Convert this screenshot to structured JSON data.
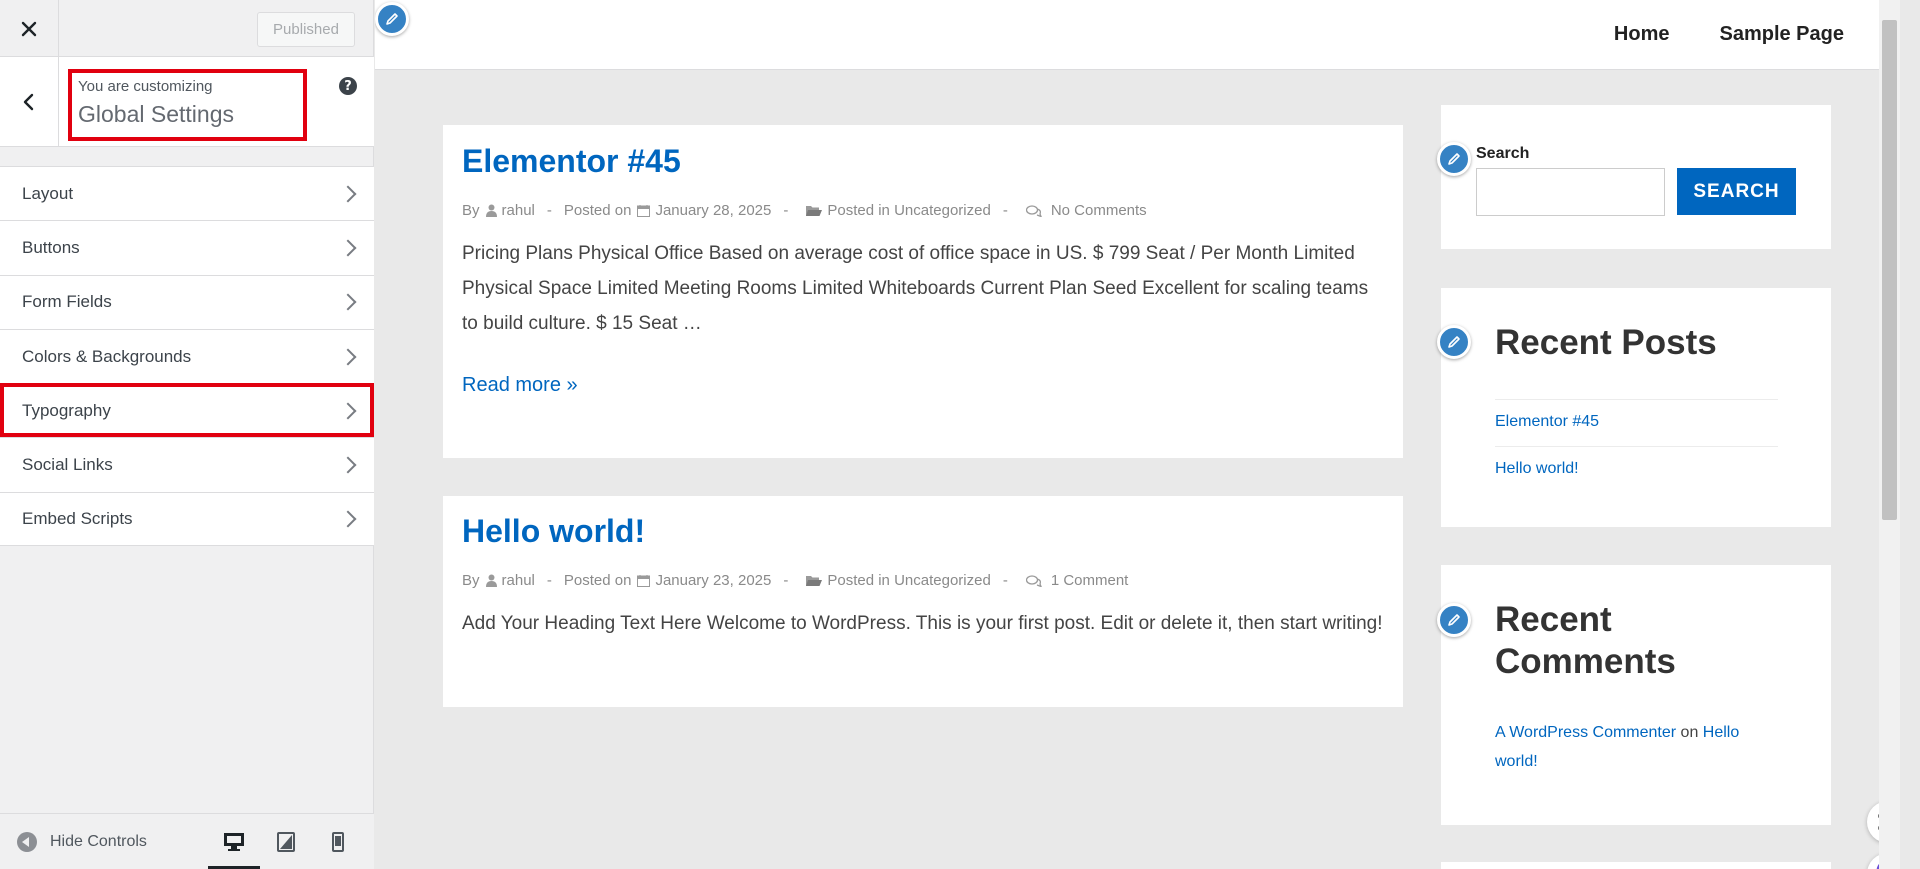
{
  "sidebar": {
    "publish_label": "Published",
    "title_pre": "You are customizing",
    "title_main": "Global Settings",
    "help_glyph": "?",
    "items": [
      {
        "label": "Layout"
      },
      {
        "label": "Buttons"
      },
      {
        "label": "Form Fields"
      },
      {
        "label": "Colors & Backgrounds"
      },
      {
        "label": "Typography"
      },
      {
        "label": "Social Links"
      },
      {
        "label": "Embed Scripts"
      }
    ],
    "hide_controls": "Hide Controls",
    "devices": [
      "desktop-icon",
      "tablet-icon",
      "mobile-icon"
    ]
  },
  "nav": {
    "home": "Home",
    "sample_page": "Sample Page"
  },
  "posts": [
    {
      "title": "Elementor #45",
      "by": "By",
      "author": "rahul",
      "posted_on": "Posted on",
      "date": "January 28, 2025",
      "posted_in": "Posted in",
      "category": "Uncategorized",
      "comments": "No Comments",
      "excerpt": "Pricing Plans Physical Office Based on average cost of office space in US. $ 799 Seat / Per Month Limited Physical Space Limited Meeting Rooms Limited Whiteboards Current Plan Seed Excellent for scaling teams to build culture. $ 15 Seat …",
      "read_more": "Read more »"
    },
    {
      "title": "Hello world!",
      "by": "By",
      "author": "rahul",
      "posted_on": "Posted on",
      "date": "January 23, 2025",
      "posted_in": "Posted in",
      "category": "Uncategorized",
      "comments": "1 Comment",
      "excerpt": "Add Your Heading Text Here Welcome to WordPress. This is your first post. Edit or delete it, then start writing!"
    }
  ],
  "widgets": {
    "search": {
      "label": "Search",
      "button": "SEARCH"
    },
    "recent_posts": {
      "title": "Recent Posts",
      "items": [
        "Elementor #45",
        "Hello world!"
      ]
    },
    "recent_comments": {
      "title": "Recent Comments",
      "commenter": "A WordPress Commenter",
      "on": "on",
      "post": "Hello world!"
    }
  },
  "colors": {
    "accent_link": "#0066bf",
    "highlight_red": "#e1000f",
    "edit_pencil": "#3582c4"
  }
}
